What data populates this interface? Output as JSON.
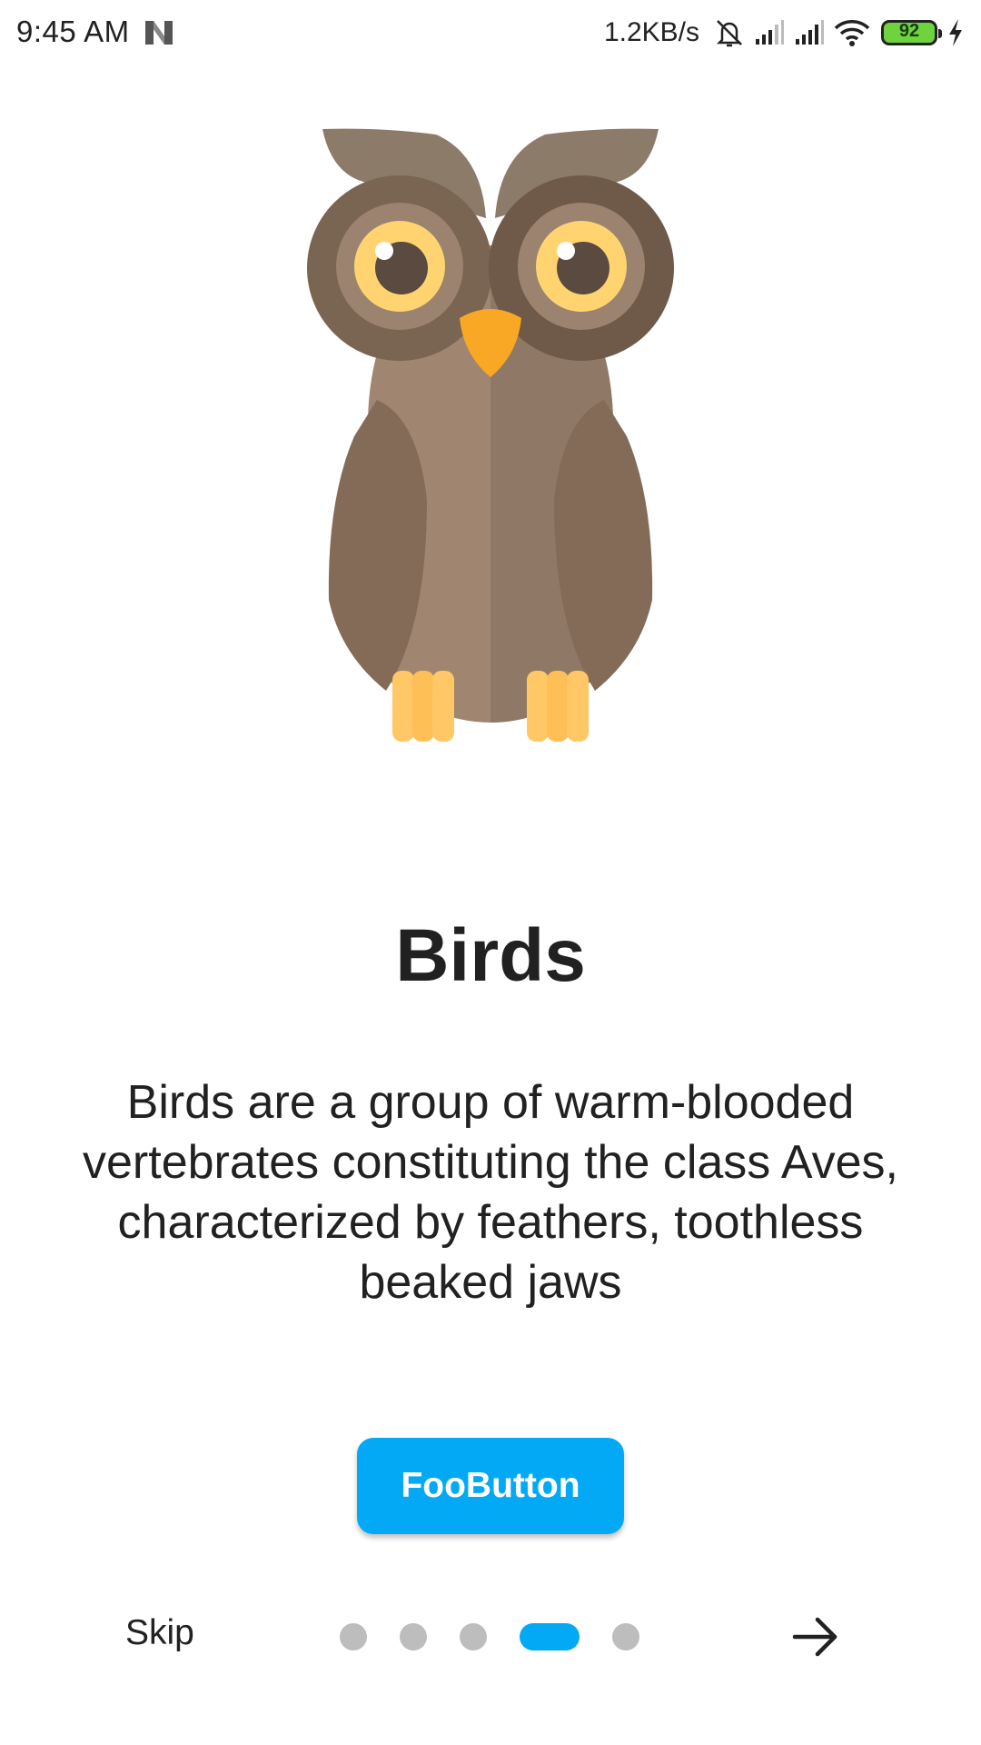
{
  "status_bar": {
    "time": "9:45 AM",
    "net_speed": "1.2KB/s",
    "battery_level": "92",
    "icons": [
      "n-notification-icon",
      "alarm-off-icon",
      "signal-icon",
      "signal-icon",
      "wifi-icon",
      "battery-icon",
      "charging-icon"
    ]
  },
  "onboarding": {
    "illustration": "owl-icon",
    "title": "Birds",
    "description": "Birds are a group of warm-blooded vertebrates constituting the class Aves, characterized by feathers, toothless beaked jaws",
    "button_label": "FooButton",
    "skip_label": "Skip",
    "page_count": 5,
    "current_page": 4,
    "next_icon": "arrow-right-icon"
  },
  "colors": {
    "accent": "#03a9f4",
    "dot_inactive": "#bdbdbd",
    "text": "#212121"
  }
}
